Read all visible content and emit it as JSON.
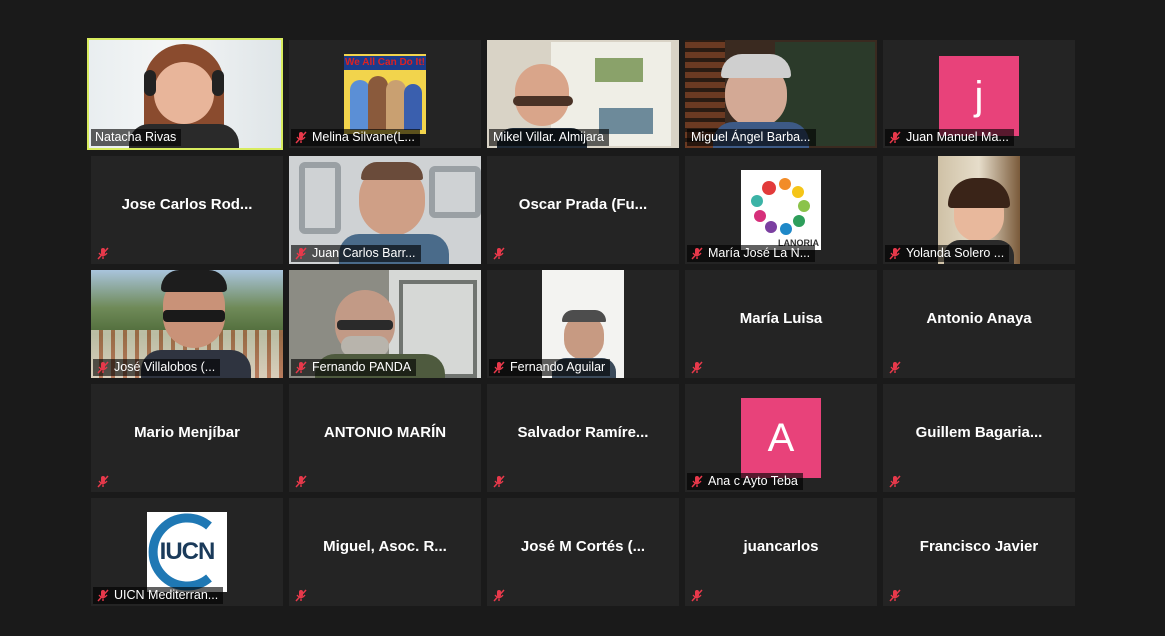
{
  "colors": {
    "background": "#1a1a1a",
    "tile": "#242424",
    "active_speaker_border": "#d8ec5f",
    "muted_icon": "#e8394b",
    "avatar_pink": "#e8427a"
  },
  "participants": [
    {
      "name": "Natacha Rivas",
      "type": "video",
      "muted": false,
      "active": true
    },
    {
      "name": "Melina Silvane(L...",
      "type": "image",
      "muted": true,
      "image_text": "We All Can Do It!"
    },
    {
      "name": "Mikel Villar. Almijara",
      "type": "video",
      "muted": false
    },
    {
      "name": "Miguel Ángel Barba...",
      "type": "video",
      "muted": false
    },
    {
      "name": "Juan Manuel Ma...",
      "type": "avatar",
      "muted": true,
      "initial": "j"
    },
    {
      "name": "Jose Carlos Rod...",
      "type": "name",
      "muted": true
    },
    {
      "name": "Juan Carlos Barr...",
      "type": "video",
      "muted": true
    },
    {
      "name": "Oscar Prada (Fu...",
      "type": "name",
      "muted": true
    },
    {
      "name": "María José La N...",
      "type": "image",
      "muted": true,
      "image_text": "LANORIA"
    },
    {
      "name": "Yolanda Solero ...",
      "type": "video",
      "muted": true
    },
    {
      "name": "José Villalobos (...",
      "type": "video",
      "muted": true
    },
    {
      "name": "Fernando PANDA",
      "type": "video",
      "muted": true
    },
    {
      "name": "Fernando Aguilar",
      "type": "video",
      "muted": true
    },
    {
      "name": "María Luisa",
      "type": "name",
      "muted": true
    },
    {
      "name": "Antonio Anaya",
      "type": "name",
      "muted": true
    },
    {
      "name": "Mario Menjíbar",
      "type": "name",
      "muted": true
    },
    {
      "name": "ANTONIO MARÍN",
      "type": "name",
      "muted": true
    },
    {
      "name": "Salvador  Ramíre...",
      "type": "name",
      "muted": true
    },
    {
      "name": "Ana c Ayto Teba",
      "type": "avatar",
      "muted": true,
      "initial": "A"
    },
    {
      "name": "Guillem  Bagaria...",
      "type": "name",
      "muted": true
    },
    {
      "name": "UICN Mediterran...",
      "type": "image",
      "muted": true,
      "image_text": "IUCN"
    },
    {
      "name": "Miguel, Asoc. R...",
      "type": "name",
      "muted": true
    },
    {
      "name": "José M Cortés (...",
      "type": "name",
      "muted": true
    },
    {
      "name": "juancarlos",
      "type": "name",
      "muted": true
    },
    {
      "name": "Francisco Javier",
      "type": "name",
      "muted": true
    }
  ]
}
